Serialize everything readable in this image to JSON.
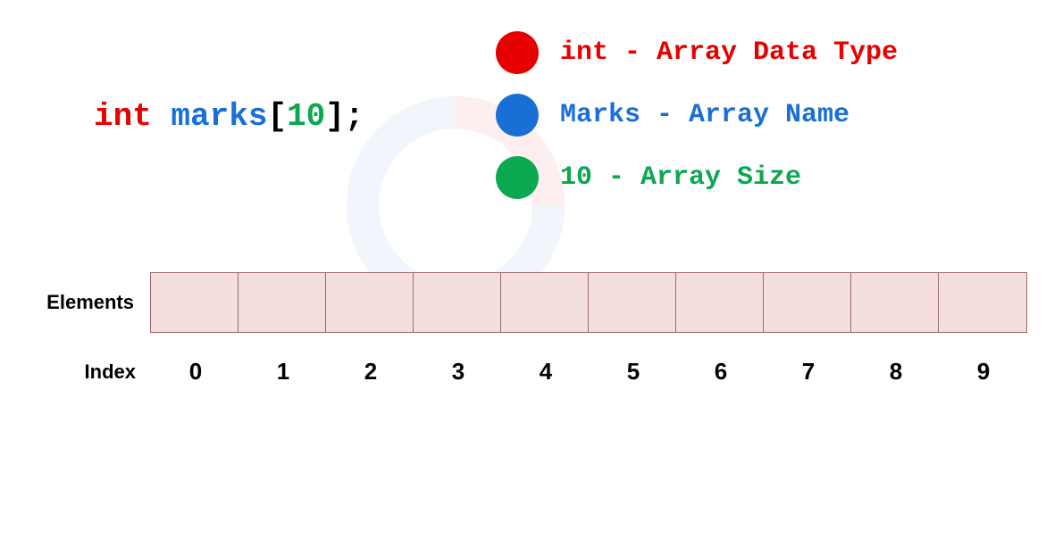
{
  "declaration": {
    "type": "int",
    "name": "marks",
    "open": "[",
    "size": "10",
    "close": "]",
    "semi": ";"
  },
  "legend": {
    "datatype": "int - Array Data Type",
    "arrayname": "Marks - Array Name",
    "arraysize": "10 - Array Size"
  },
  "labels": {
    "elements": "Elements",
    "index": "Index"
  },
  "indices": [
    "0",
    "1",
    "2",
    "3",
    "4",
    "5",
    "6",
    "7",
    "8",
    "9"
  ]
}
